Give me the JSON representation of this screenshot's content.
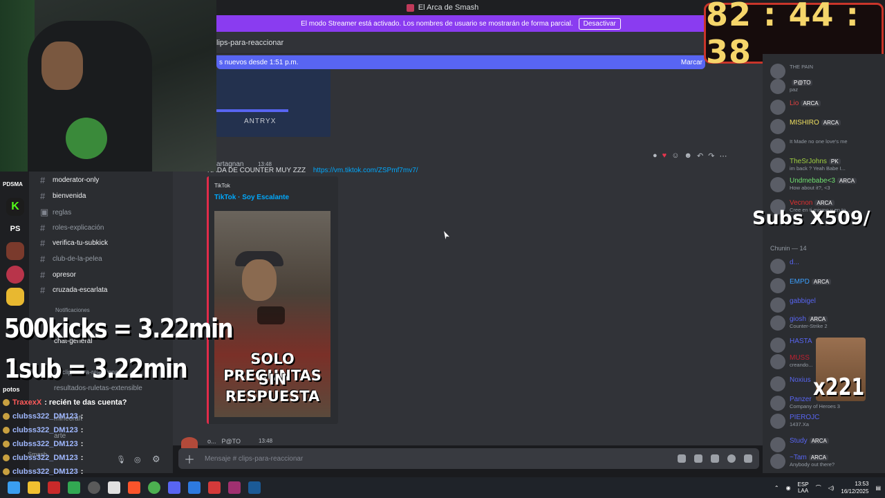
{
  "window": {
    "title": "El Arca de Smash"
  },
  "streamer_mode": {
    "text": "El modo Streamer está activado. Los nombres de usuario se mostrarán de forma parcial.",
    "button": "Desactivar"
  },
  "channel": {
    "name": "lips-para-reaccionar",
    "new_messages": "s nuevos desde 1:51 p.m.",
    "mark_read": "Marcar"
  },
  "top_image": {
    "label": "ANTRYX"
  },
  "message": {
    "author": "artagnan",
    "time": "13:48",
    "text": "NADA DE COUNTER MUY ZZZ",
    "link": "https://vm.tiktok.com/ZSPmf7mv7/",
    "embed_provider": "TikTok",
    "embed_title": "TikTok · Soy Escalante",
    "video_caption_1": "SOLO PREGUNTAS",
    "video_caption_2": "SIN RESPUESTA"
  },
  "next_message": {
    "author": "o...",
    "tag": "P@TO",
    "time": "13:48"
  },
  "composer": {
    "placeholder": "Mensaje # clips-para-reaccionar"
  },
  "sidebar": {
    "server_label": "PDSMA",
    "channels": [
      {
        "name": "moderator-only"
      },
      {
        "name": "bienvenida"
      },
      {
        "name": "reglas"
      },
      {
        "name": "roles-explicación"
      },
      {
        "name": "verifica-tu-subkick"
      },
      {
        "name": "club-de-la-pelea"
      },
      {
        "name": "opresor"
      },
      {
        "name": "cruzada-escarlata"
      },
      {
        "name": "Notificaciones"
      },
      {
        "name": "chat-general"
      },
      {
        "name": "clips-para-reaccionar"
      },
      {
        "name": "resultados-ruletas-extensible"
      },
      {
        "name": "minecraft"
      },
      {
        "name": "arte"
      },
      {
        "name": "Smash"
      }
    ],
    "server_ps": "PS",
    "category": "potos"
  },
  "timer": {
    "value": "82 : 44 : 38"
  },
  "overlays": {
    "subs": "Subs X509/",
    "kicks": "500kicks = 3.22min",
    "sub": "1sub = 3.22min",
    "multiplier": "x221"
  },
  "members": {
    "section": "Chunin — 14",
    "list": [
      {
        "name": "",
        "tag": "",
        "status": "THE PAIN"
      },
      {
        "name": "",
        "tag": "P@TO",
        "status": "paz"
      },
      {
        "name": "Lio",
        "tag": "ARCA",
        "status": ""
      },
      {
        "name": "MISHIRO",
        "tag": "ARCA",
        "status": ""
      },
      {
        "name": "",
        "tag": "",
        "status": "It Made no one love's me"
      },
      {
        "name": "TheSrJohns",
        "tag": "PK",
        "status": "im back ? Yeah Babe I..."
      },
      {
        "name": "Undmebabe<3",
        "tag": "ARCA",
        "status": "How about it?, <3"
      },
      {
        "name": "Vecnon",
        "tag": "ARCA",
        "status": "Cree en ti mismo y en to..."
      },
      {
        "name": "d...",
        "tag": "",
        "status": ""
      },
      {
        "name": "EMPD",
        "tag": "ARCA",
        "status": ""
      },
      {
        "name": "gabbigel",
        "tag": "",
        "status": ""
      },
      {
        "name": "giosh",
        "tag": "ARCA",
        "status": "Counter-Strike 2"
      },
      {
        "name": "HASTA",
        "tag": "",
        "status": ""
      },
      {
        "name": "MUSS",
        "tag": "",
        "status": "creando..."
      },
      {
        "name": "Noxius",
        "tag": "",
        "status": ""
      },
      {
        "name": "Panzer",
        "tag": "",
        "status": "Company of Heroes 3"
      },
      {
        "name": "PIEROJC",
        "tag": "",
        "status": "1437.Xa"
      },
      {
        "name": "Study",
        "tag": "ARCA",
        "status": ""
      },
      {
        "name": "~Tam",
        "tag": "ARCA",
        "status": "Anybody out there?"
      }
    ]
  },
  "chat": [
    {
      "user": "TraxexX",
      "msg": ": recién te das cuenta?"
    },
    {
      "user": "clubss322_DM123",
      "msg": ":"
    },
    {
      "user": "clubss322_DM123",
      "msg": ":"
    },
    {
      "user": "clubss322_DM123",
      "msg": ":"
    },
    {
      "user": "clubss322_DM123",
      "msg": ":"
    },
    {
      "user": "clubss322_DM123",
      "msg": ":"
    }
  ],
  "tray": {
    "lang": "ESP",
    "layout": "LAA",
    "time": "13:53",
    "date": "16/12/2025"
  },
  "colors": {
    "accent": "#5865f2",
    "streamer": "#8a3cf0",
    "timer_digits": "#f5d56a"
  }
}
